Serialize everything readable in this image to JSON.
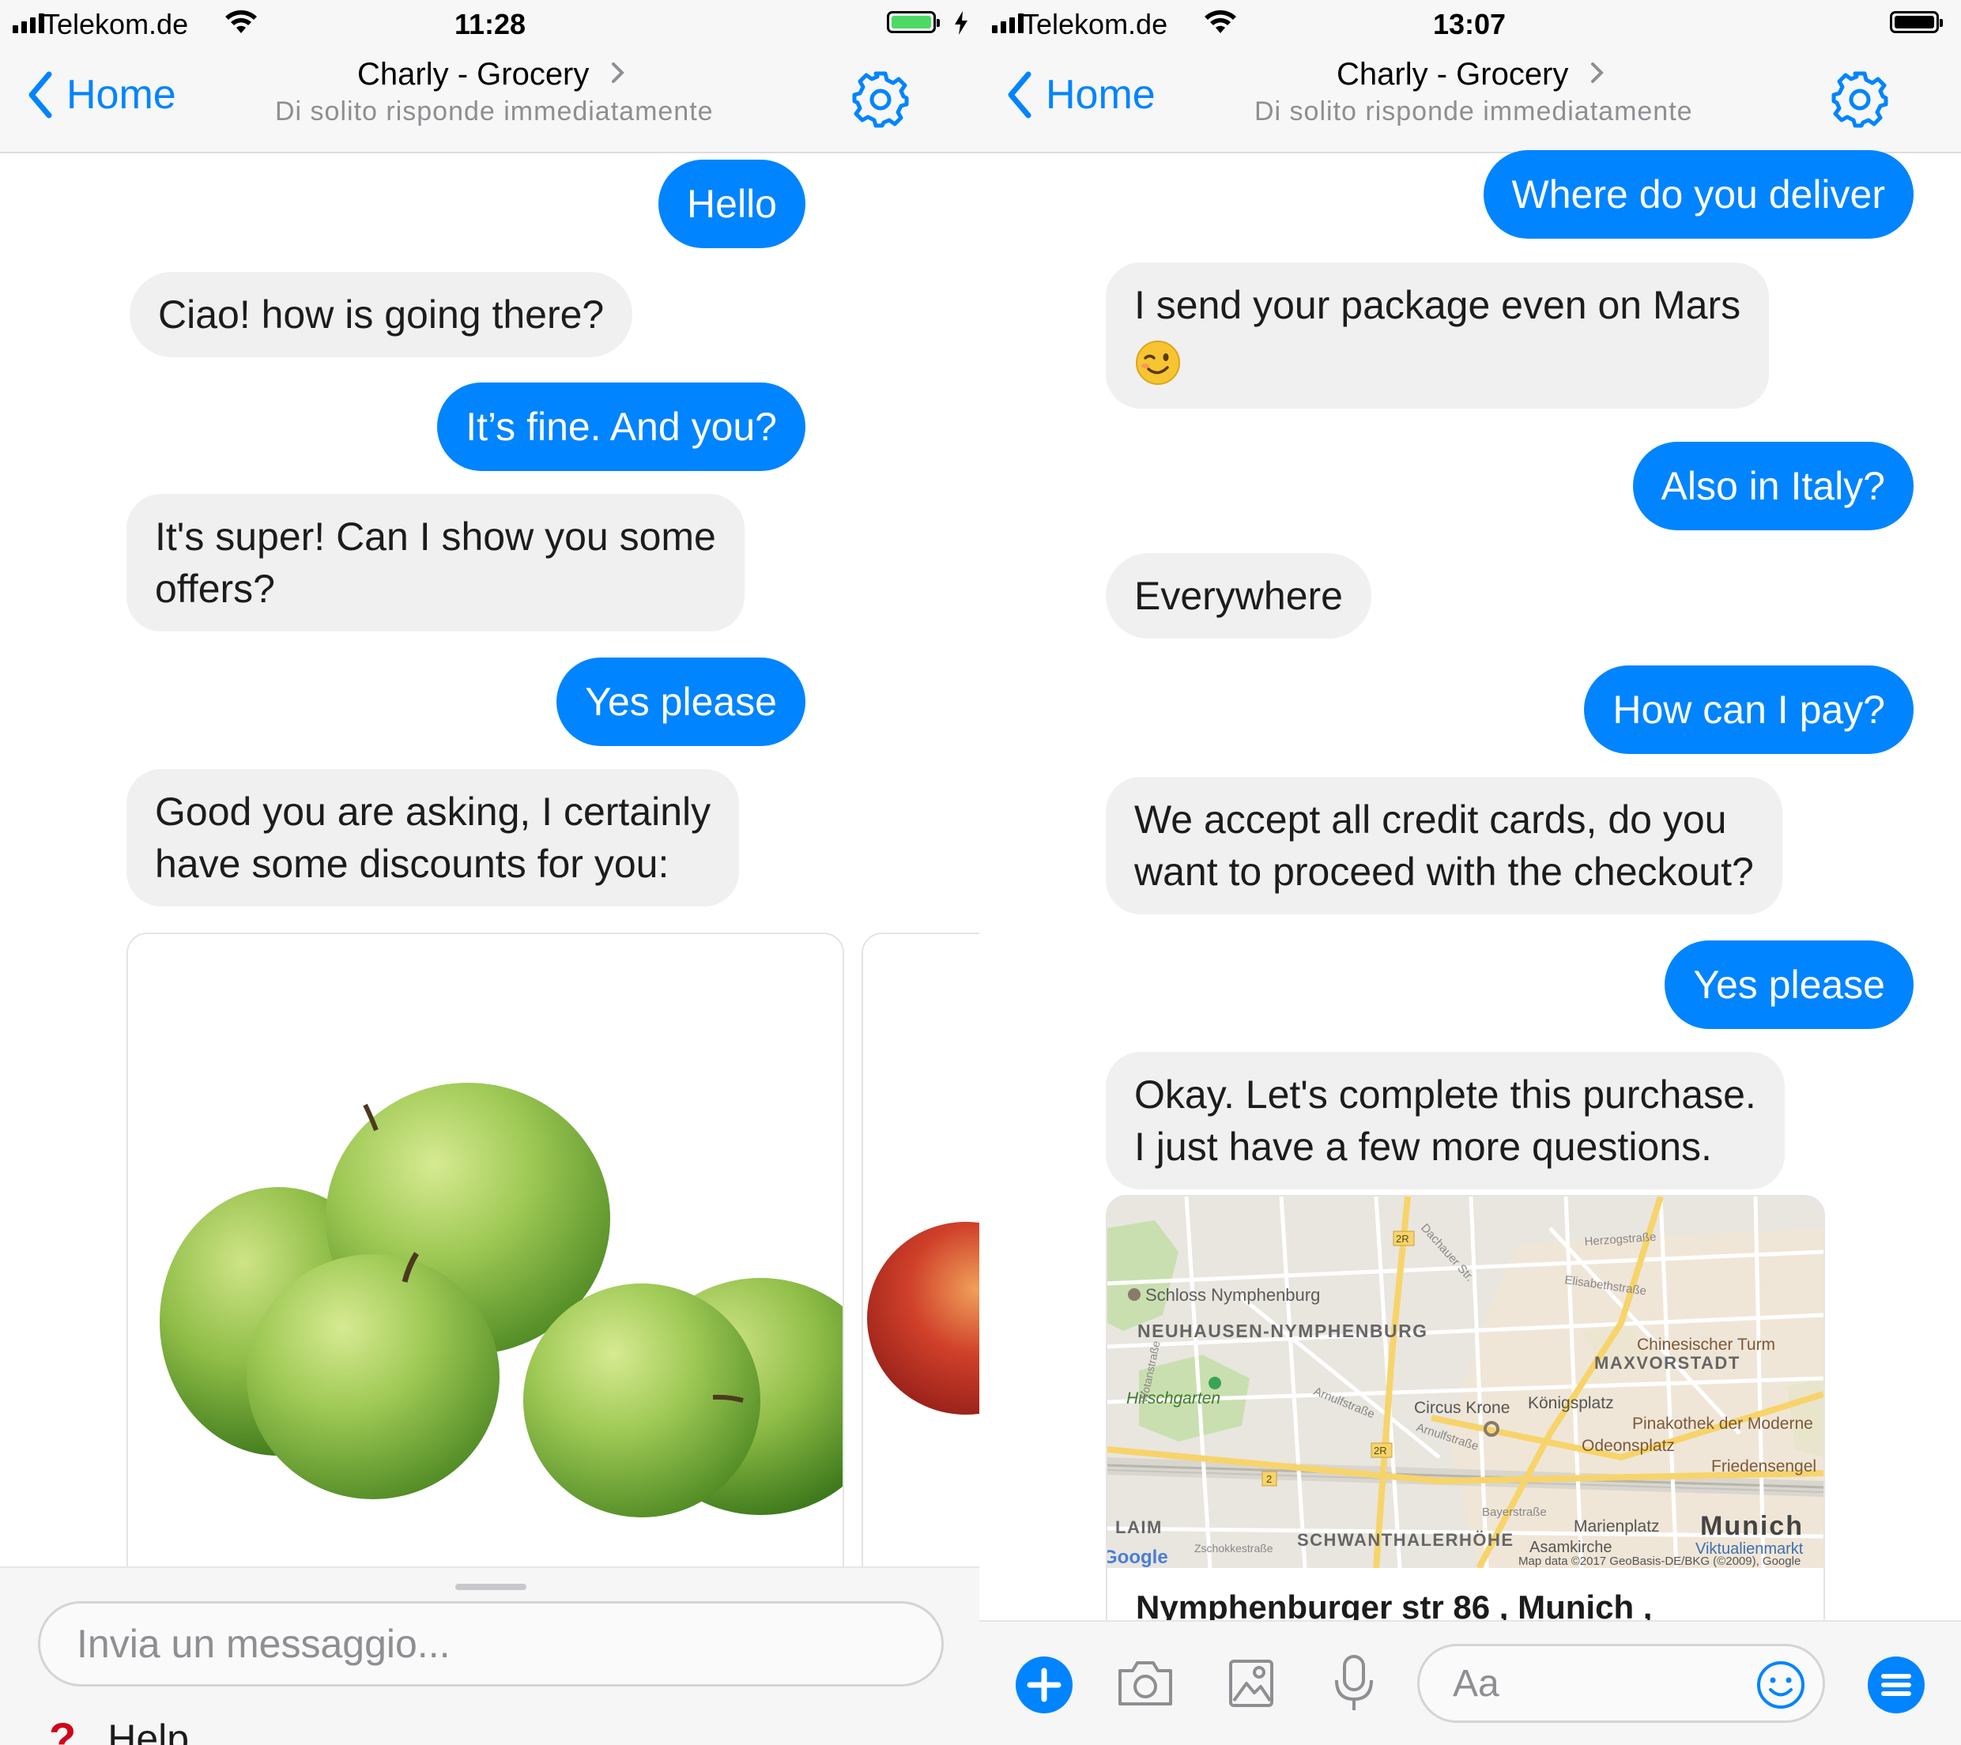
{
  "left_screen": {
    "status": {
      "carrier": "Telekom.de",
      "time": "11:28"
    },
    "nav": {
      "back_label": "Home",
      "title": "Charly - Grocery",
      "subtitle": "Di solito risponde immediatamente"
    },
    "messages": [
      {
        "from": "user",
        "text": "Hello"
      },
      {
        "from": "bot",
        "text": "Ciao! how is going there?"
      },
      {
        "from": "user",
        "text": "It’s fine. And you?"
      },
      {
        "from": "bot",
        "line1": "It's super! Can I show you some",
        "line2": "offers?"
      },
      {
        "from": "user",
        "text": "Yes please"
      },
      {
        "from": "bot",
        "line1": "Good you are asking, I certainly",
        "line2": "have some discounts for you:"
      }
    ],
    "carousel": {
      "items": [
        "green-apples-image",
        "red-apple-image"
      ]
    },
    "composer": {
      "placeholder": "Invia un messaggio...",
      "menu_label": "Help",
      "menu_icon": "question-mark-icon"
    }
  },
  "right_screen": {
    "status": {
      "carrier": "Telekom.de",
      "time": "13:07"
    },
    "nav": {
      "back_label": "Home",
      "title": "Charly - Grocery",
      "subtitle": "Di solito risponde immediatamente"
    },
    "messages": [
      {
        "from": "user",
        "text": "Where do you deliver"
      },
      {
        "from": "bot",
        "line1": "I send your package even on Mars",
        "emoji": "winking-face-emoji"
      },
      {
        "from": "user",
        "text": "Also in Italy?"
      },
      {
        "from": "bot",
        "text": "Everywhere"
      },
      {
        "from": "user",
        "text": "How can I pay?"
      },
      {
        "from": "bot",
        "line1": "We accept all credit cards, do you",
        "line2": "want to proceed with the checkout?"
      },
      {
        "from": "user",
        "text": "Yes please"
      },
      {
        "from": "bot",
        "line1": "Okay. Let's complete this purchase.",
        "line2": "I just have a few more questions."
      }
    ],
    "map_card": {
      "address": "Nymphenburger str 86 , Munich ,",
      "labels": {
        "schloss": "Schloss Nymphenburg",
        "district1": "NEUHAUSEN-NYMPHENBURG",
        "hirschgarten": "Hirschgarten",
        "maxvorstadt": "MAXVORSTADT",
        "chinesischer": "Chinesischer Turm",
        "circus": "Circus Krone",
        "koenigsplatz": "Königsplatz",
        "pinakothek": "Pinakothek der Moderne",
        "odeonsplatz": "Odeonsplatz",
        "friedensengel": "Friedensengel",
        "laim": "LAIM",
        "schwanthaler": "SCHWANTHALERHÖHE",
        "marienplatz": "Marienplatz",
        "munich": "Munich",
        "asamkirche": "Asamkirche",
        "viktualienmarkt": "Viktualienmarkt",
        "arnulf1": "Arnulfstraße",
        "arnulf2": "Arnulfstraße",
        "dachauer": "Dachauer Str.",
        "herzog": "Herzogstraße",
        "elisabeth": "Elisabethstraße",
        "wotan": "Wotanstraße",
        "bayer": "Bayerstraße",
        "zschokke": "Zschokkestraße",
        "google": "Google",
        "attribution": "Map data ©2017 GeoBasis-DE/BKG (©2009), Google",
        "r2r_a": "2R",
        "r2r_b": "2R",
        "r2": "2"
      }
    },
    "composer": {
      "placeholder": "Aa",
      "icons": [
        "plus-circle-icon",
        "camera-icon",
        "image-icon",
        "microphone-icon",
        "smiley-icon",
        "menu-icon"
      ]
    }
  },
  "colors": {
    "messenger_blue": "#0084ff",
    "bot_bubble": "#f0f0f0",
    "battery_green": "#4cd964",
    "help_red": "#d0021b"
  }
}
